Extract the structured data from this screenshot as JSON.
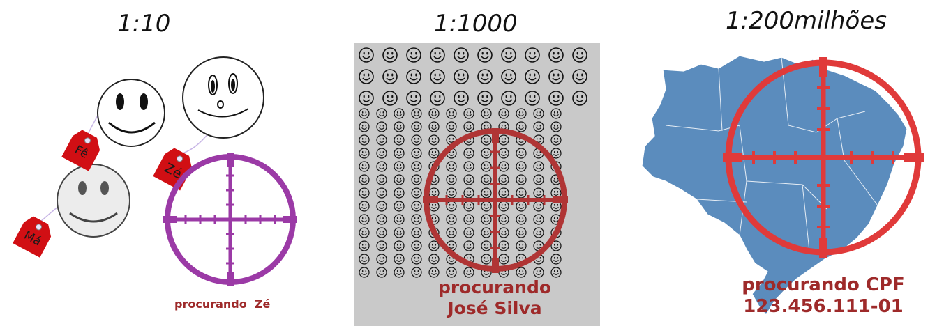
{
  "panels": [
    {
      "scale": "1:10",
      "caption_1": "procurando",
      "caption_2": "Zé",
      "tags": [
        "Fê",
        "Zé",
        "Má"
      ]
    },
    {
      "scale": "1:1000",
      "caption_1": "procurando",
      "caption_2": "José Silva"
    },
    {
      "scale": "1:200milhões",
      "caption_1": "procurando CPF",
      "caption_2": "123.456.111-01"
    }
  ],
  "colors": {
    "crosshair_purple": "#9b3aa6",
    "crosshair_darkred": "#b03535",
    "crosshair_red": "#e03a3a",
    "caption_red": "#9e2a2a",
    "map_blue": "#5b8cbd",
    "tag_red": "#d10f14",
    "panel_gray": "#c9c9c9"
  },
  "icons": [
    "smiley-face-icon",
    "price-tag-icon",
    "crosshair-icon",
    "brazil-map-icon"
  ]
}
